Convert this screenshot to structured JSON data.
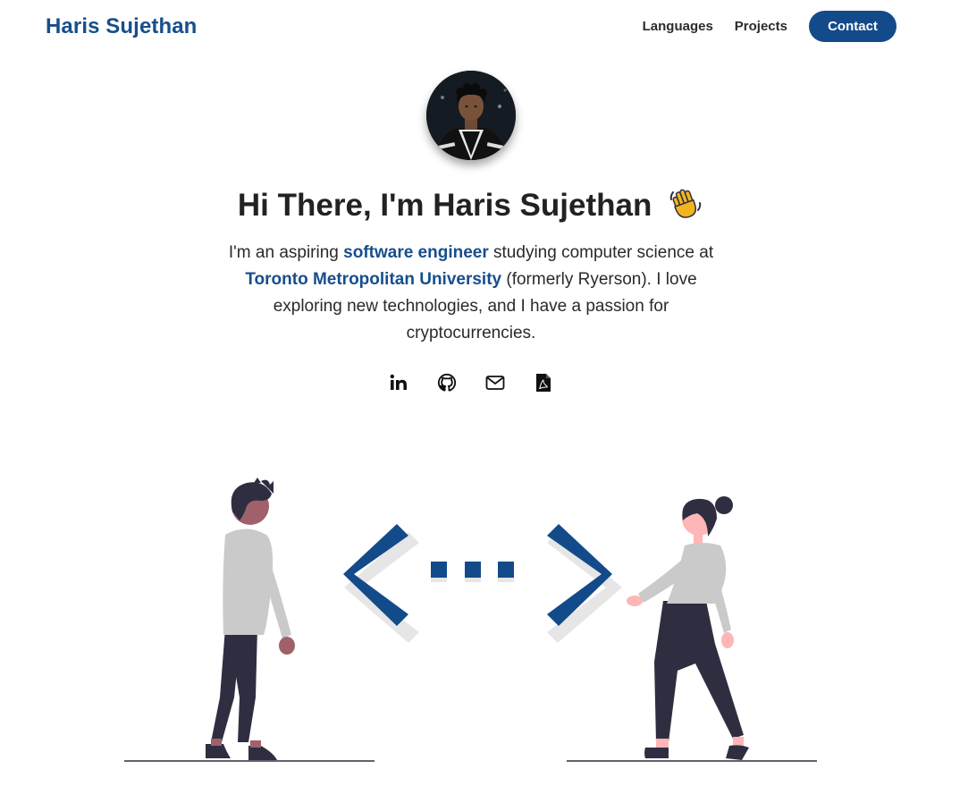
{
  "header": {
    "brand": "Haris Sujethan",
    "nav": [
      {
        "label": "Languages"
      },
      {
        "label": "Projects"
      },
      {
        "label": "Contact"
      }
    ]
  },
  "hero": {
    "title": "Hi There, I'm Haris Sujethan",
    "title_icon": "waving-hand-icon",
    "bio": {
      "p1": "I'm an aspiring ",
      "link1": "software engineer",
      "p2": " studying computer science at ",
      "link2": "Toronto Metropolitan University",
      "p3": " (formerly Ryerson). I love exploring new technologies, and I have a passion for cryptocurrencies."
    }
  },
  "socials": [
    {
      "icon": "linkedin-icon"
    },
    {
      "icon": "github-icon"
    },
    {
      "icon": "email-icon"
    },
    {
      "icon": "pdf-resume-icon"
    }
  ],
  "colors": {
    "brand": "#174e8c",
    "button": "#134b8a",
    "text": "#222222",
    "illustration_dark": "#2f2e41",
    "illustration_gray": "#cacaca",
    "illustration_skin_dark": "#a0616a",
    "illustration_skin_light": "#ffb6b6"
  }
}
